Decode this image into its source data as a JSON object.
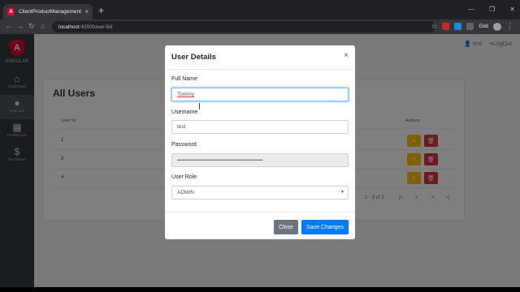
{
  "browser": {
    "tab_title": "ClientProductManagement",
    "tab_close": "×",
    "new_tab": "+",
    "url_host": "localhost",
    "url_path": ":4200/user-list",
    "profile_name": "Gidi",
    "win_controls": [
      "—",
      "❐",
      "✕"
    ]
  },
  "sidebar": {
    "logo_letter": "A",
    "logo_text": "ANGULAR",
    "items": [
      {
        "icon": "home-icon",
        "glyph": "⌂",
        "label": "Dashboard"
      },
      {
        "icon": "user-icon",
        "glyph": "●",
        "label": "User List"
      },
      {
        "icon": "grid-icon",
        "glyph": "▦",
        "label": "Product List"
      },
      {
        "icon": "dollar-icon",
        "glyph": "$",
        "label": "Purchases"
      }
    ]
  },
  "topnav": {
    "user": "test",
    "logout": "LogOut"
  },
  "users_card": {
    "title": "All Users",
    "headers": [
      "User Id",
      "Actions"
    ],
    "rows": [
      {
        "id": "1"
      },
      {
        "id": "3"
      },
      {
        "id": "4"
      }
    ],
    "pager": {
      "info": "1 - 3 of 3",
      "buttons": [
        "|<",
        "<",
        ">",
        ">|"
      ]
    }
  },
  "modal": {
    "title": "User Details",
    "close": "×",
    "fields": {
      "full_name": {
        "label": "Full Name",
        "value": "Tommy"
      },
      "username": {
        "label": "Username",
        "value": "test"
      },
      "password": {
        "label": "Password",
        "value": "••••••••••••••••••••••••••••••••••••••••••••••••••••••••••••••••••••"
      },
      "role": {
        "label": "User Role",
        "value": "ADMIN"
      }
    },
    "close_button": "Close",
    "save_button": "Save Changes"
  },
  "colors": {
    "primary": "#007bff",
    "secondary": "#6c757d",
    "warning": "#ffc107",
    "danger": "#dc3545",
    "sidebar": "#343a40",
    "angular": "#dd0031"
  }
}
